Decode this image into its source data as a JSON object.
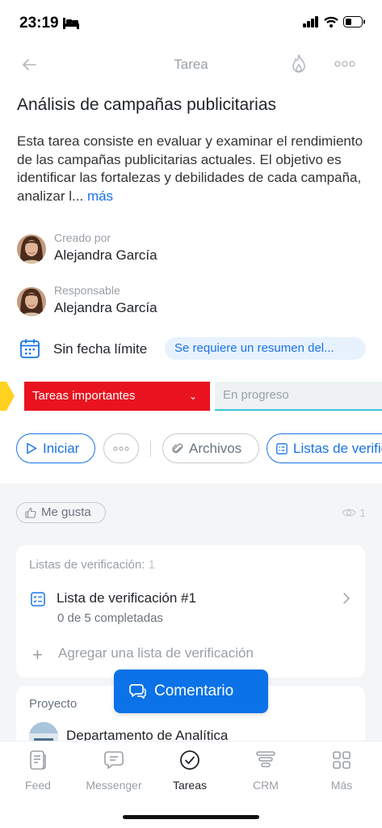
{
  "status": {
    "time": "23:19"
  },
  "nav": {
    "title": "Tarea"
  },
  "task": {
    "title": "Análisis de campañas publicitarias",
    "description": "Esta tarea consiste en evaluar y examinar el rendimiento de las campañas publicitarias actuales. El objetivo es identificar las fortalezas y debilidades de cada campaña, analizar l...",
    "more_label": "más"
  },
  "people": {
    "creator": {
      "role": "Creado por",
      "name": "Alejandra García"
    },
    "responsible": {
      "role": "Responsable",
      "name": "Alejandra García"
    }
  },
  "deadline": {
    "text": "Sin fecha límite",
    "summary_chip": "Se requiere un resumen del..."
  },
  "stages": {
    "current": "Tareas importantes",
    "next": "En progreso"
  },
  "actions": {
    "start": "Iniciar",
    "files": "Archivos",
    "lists": "Listas de verificación"
  },
  "social": {
    "like": "Me gusta",
    "views": "1"
  },
  "checklists": {
    "title": "Listas de verificación:",
    "count": "1",
    "items": [
      {
        "name": "Lista de verificación #1",
        "progress": "0 de 5 completadas"
      }
    ],
    "add_label": "Agregar una lista de verificación"
  },
  "project": {
    "label": "Proyecto",
    "name": "Departamento de Analítica"
  },
  "comment_button": "Comentario",
  "tabs": [
    {
      "label": "Feed",
      "icon": "feed-icon"
    },
    {
      "label": "Messenger",
      "icon": "messenger-icon"
    },
    {
      "label": "Tareas",
      "icon": "tasks-icon"
    },
    {
      "label": "CRM",
      "icon": "crm-icon"
    },
    {
      "label": "Más",
      "icon": "grid-icon"
    }
  ],
  "colors": {
    "accent": "#1a73e8",
    "stage_current": "#e8131f",
    "stage_previous": "#ffd21f",
    "stage_next_underline": "#3dc3d6",
    "comment_button": "#0b72e7"
  }
}
